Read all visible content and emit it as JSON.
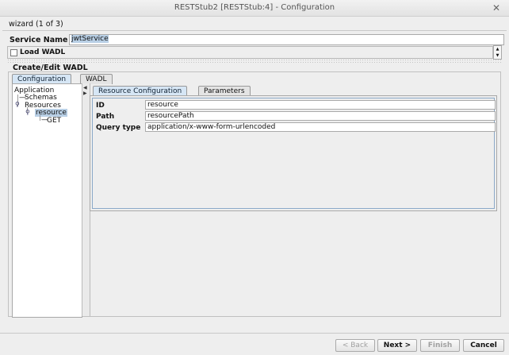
{
  "window": {
    "title": "RESTStub2 [RESTStub:4] - Configuration",
    "close_glyph": "✕"
  },
  "wizard": {
    "step": "wizard (1 of 3)"
  },
  "service": {
    "label": "Service Name",
    "value": "jwtService"
  },
  "load_wadl": {
    "label": "Load WADL",
    "checked": false
  },
  "create_edit": {
    "title": "Create/Edit WADL",
    "tabs": [
      {
        "label": "Configuration"
      },
      {
        "label": "WADL"
      }
    ],
    "tree": {
      "application": "Application",
      "schemas": "Schemas",
      "resources": "Resources",
      "resource": "resource",
      "get": "GET"
    },
    "detail_tabs": [
      {
        "label": "Resource Configuration"
      },
      {
        "label": "Parameters"
      }
    ],
    "fields": [
      {
        "label": "ID",
        "value": "resource"
      },
      {
        "label": "Path",
        "value": "resourcePath"
      },
      {
        "label": "Query type",
        "value": "application/x-www-form-urlencoded"
      }
    ]
  },
  "buttons": {
    "back": "< Back",
    "next": "Next >",
    "finish": "Finish",
    "cancel": "Cancel"
  },
  "icons": {
    "expand": "expand-handle-icon"
  },
  "colors": {
    "selection": "#b8cfe5",
    "active_tab": "#d6e6f5"
  }
}
